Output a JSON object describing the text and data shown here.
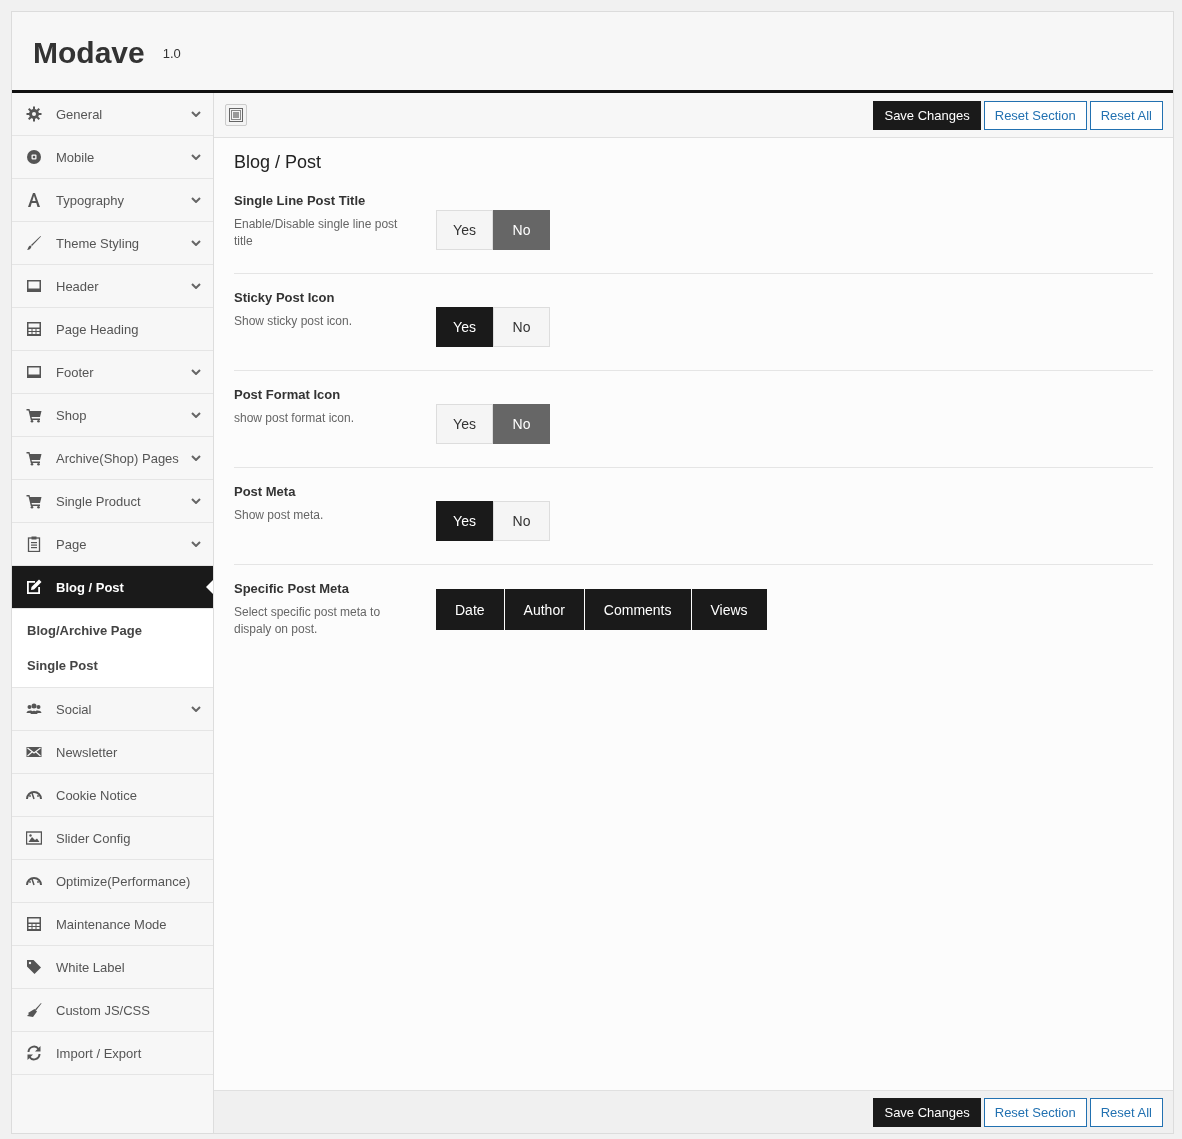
{
  "header": {
    "title": "Modave",
    "version": "1.0"
  },
  "sidebar": {
    "items": [
      {
        "label": "General",
        "expandable": true,
        "selected": false
      },
      {
        "label": "Mobile",
        "expandable": true,
        "selected": false
      },
      {
        "label": "Typography",
        "expandable": true,
        "selected": false
      },
      {
        "label": "Theme Styling",
        "expandable": true,
        "selected": false
      },
      {
        "label": "Header",
        "expandable": true,
        "selected": false
      },
      {
        "label": "Page Heading",
        "expandable": false,
        "selected": false
      },
      {
        "label": "Footer",
        "expandable": true,
        "selected": false
      },
      {
        "label": "Shop",
        "expandable": true,
        "selected": false
      },
      {
        "label": "Archive(Shop) Pages",
        "expandable": true,
        "selected": false
      },
      {
        "label": "Single Product",
        "expandable": true,
        "selected": false
      },
      {
        "label": "Page",
        "expandable": true,
        "selected": false
      },
      {
        "label": "Blog / Post",
        "expandable": false,
        "selected": true,
        "children": [
          {
            "label": "Blog/Archive Page"
          },
          {
            "label": "Single Post"
          }
        ]
      },
      {
        "label": "Social",
        "expandable": true,
        "selected": false
      },
      {
        "label": "Newsletter",
        "expandable": false,
        "selected": false
      },
      {
        "label": "Cookie Notice",
        "expandable": false,
        "selected": false
      },
      {
        "label": "Slider Config",
        "expandable": false,
        "selected": false
      },
      {
        "label": "Optimize(Performance)",
        "expandable": false,
        "selected": false
      },
      {
        "label": "Maintenance Mode",
        "expandable": false,
        "selected": false
      },
      {
        "label": "White Label",
        "expandable": false,
        "selected": false
      },
      {
        "label": "Custom JS/CSS",
        "expandable": false,
        "selected": false
      },
      {
        "label": "Import / Export",
        "expandable": false,
        "selected": false
      }
    ]
  },
  "toolbar": {
    "buttons": [
      {
        "label": "Save Changes",
        "kind": "primary"
      },
      {
        "label": "Reset Section",
        "kind": "secondary"
      },
      {
        "label": "Reset All",
        "kind": "secondary"
      }
    ]
  },
  "section": {
    "title": "Blog / Post",
    "fields": [
      {
        "kind": "toggle",
        "title": "Single Line Post Title",
        "description": "Enable/Disable single line post title",
        "options": [
          {
            "label": "Yes",
            "selected": false
          },
          {
            "label": "No",
            "selected": true
          }
        ]
      },
      {
        "kind": "toggle",
        "title": "Sticky Post Icon",
        "description": "Show sticky post icon.",
        "options": [
          {
            "label": "Yes",
            "selected": true
          },
          {
            "label": "No",
            "selected": false
          }
        ]
      },
      {
        "kind": "toggle",
        "title": "Post Format Icon",
        "description": "show post format icon.",
        "options": [
          {
            "label": "Yes",
            "selected": false
          },
          {
            "label": "No",
            "selected": true
          }
        ]
      },
      {
        "kind": "toggle",
        "title": "Post Meta",
        "description": "Show post meta.",
        "options": [
          {
            "label": "Yes",
            "selected": true
          },
          {
            "label": "No",
            "selected": false
          }
        ]
      },
      {
        "kind": "multi",
        "title": "Specific Post Meta",
        "description": "Select specific post meta to dispaly on post.",
        "options": [
          {
            "label": "Date",
            "selected": true
          },
          {
            "label": "Author",
            "selected": true
          },
          {
            "label": "Comments",
            "selected": true
          },
          {
            "label": "Views",
            "selected": true
          }
        ]
      }
    ]
  },
  "footer": {
    "buttons": [
      {
        "label": "Save Changes",
        "kind": "primary"
      },
      {
        "label": "Reset Section",
        "kind": "secondary"
      },
      {
        "label": "Reset All",
        "kind": "secondary"
      }
    ]
  }
}
